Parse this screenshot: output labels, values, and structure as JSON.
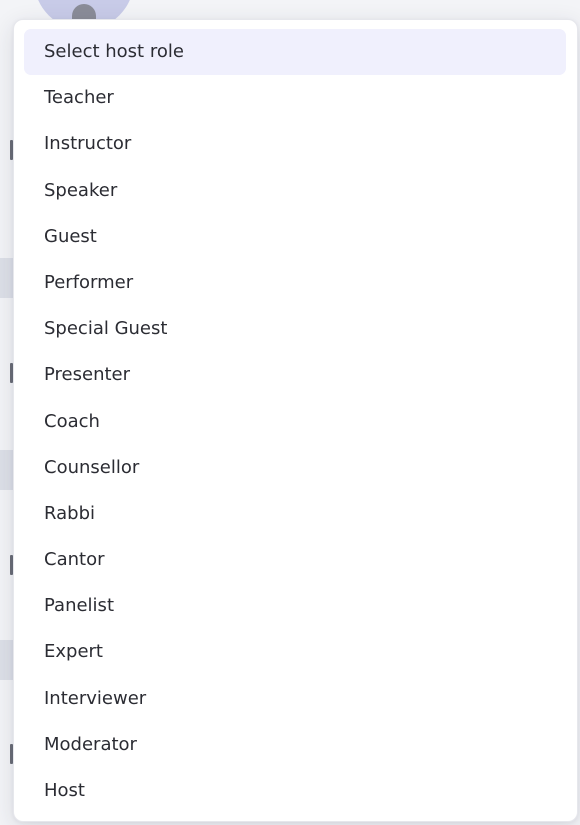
{
  "host_role_dropdown": {
    "placeholder": "Select host role",
    "options": [
      "Teacher",
      "Instructor",
      "Speaker",
      "Guest",
      "Performer",
      "Special Guest",
      "Presenter",
      "Coach",
      "Counsellor",
      "Rabbi",
      "Cantor",
      "Panelist",
      "Expert",
      "Interviewer",
      "Moderator",
      "Host"
    ]
  },
  "colors": {
    "highlight": "#f0f0fd",
    "text": "#2b2c33",
    "panel": "#ffffff"
  }
}
